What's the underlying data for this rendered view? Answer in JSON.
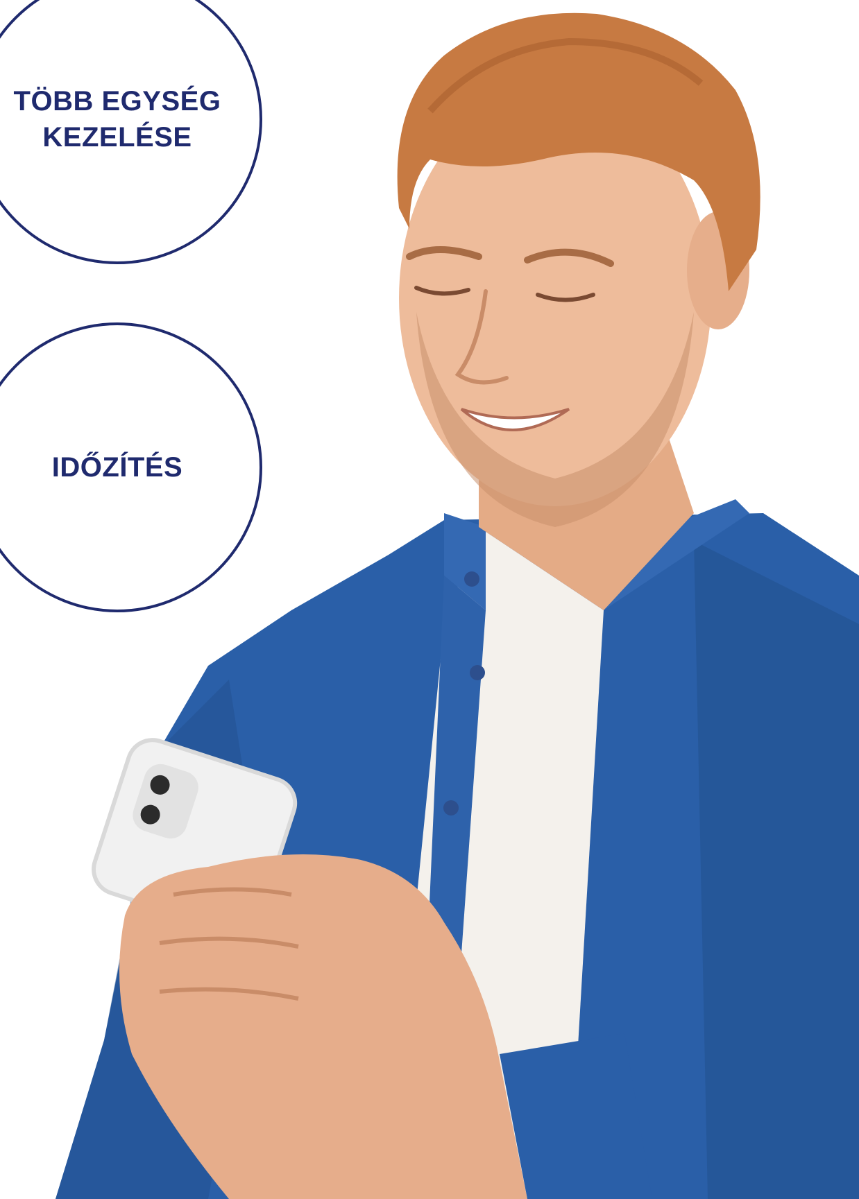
{
  "features": [
    {
      "label": "TÖBB EGYSÉG KEZELÉSE"
    },
    {
      "label": "IDŐZÍTÉS"
    }
  ],
  "colors": {
    "accent": "#1f2a6e",
    "shirt": "#2a5fa8",
    "tshirt": "#f4f1ec",
    "skin": "#e9b896",
    "hair": "#c77a42",
    "phone": "#f1f1f1"
  },
  "photo": {
    "subject": "smiling-man-with-phone"
  }
}
